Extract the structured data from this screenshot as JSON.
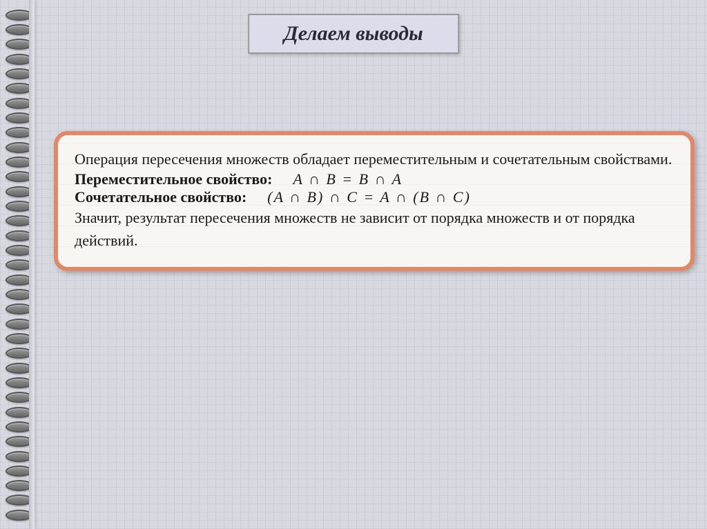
{
  "title": "Делаем выводы",
  "content": {
    "intro": "Операция пересечения множеств обладает переместительным и сочетательным свойствами.",
    "prop1_label": "Переместительное свойство:",
    "prop1_formula": "A  ∩  B = B  ∩  A",
    "prop2_label": "Сочетательное свойство:",
    "prop2_formula": "(A ∩ B)  ∩  C = A ∩ (B ∩ C)",
    "conclusion": "Значит, результат пересечения множеств не зависит от порядка множеств и от порядка действий."
  }
}
